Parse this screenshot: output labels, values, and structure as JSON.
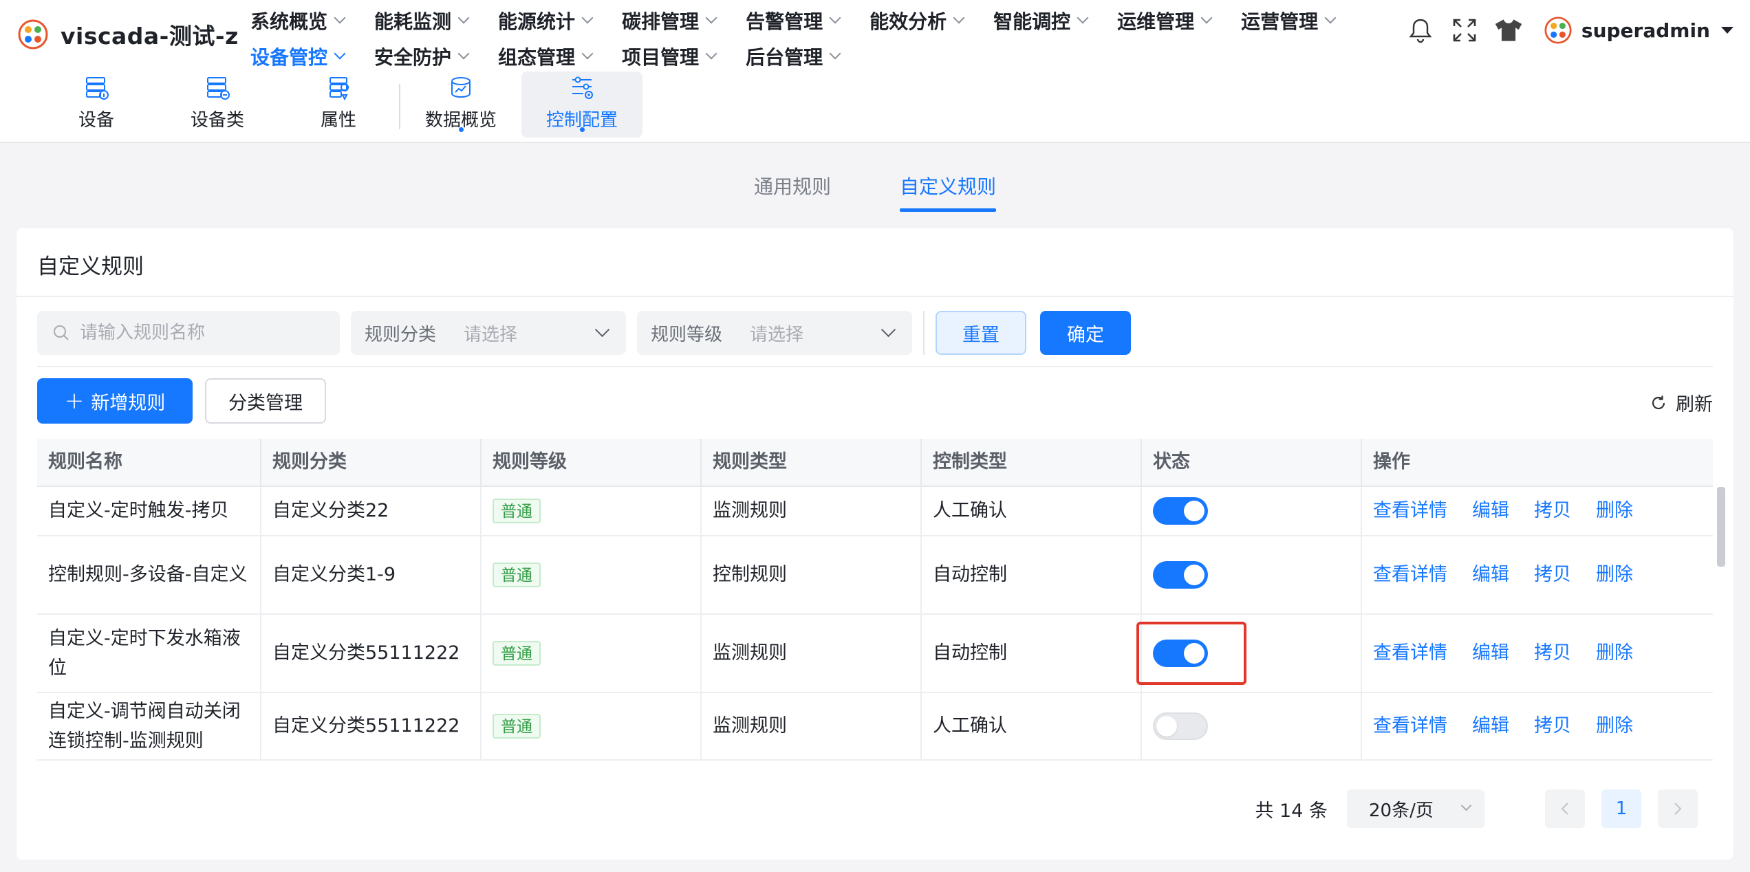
{
  "app": {
    "title": "viscada-测试-z"
  },
  "nav": {
    "row1": [
      "系统概览",
      "能耗监测",
      "能源统计",
      "碳排管理",
      "告警管理",
      "能效分析",
      "智能调控",
      "运维管理",
      "运营管理"
    ],
    "row2": [
      "设备管控",
      "安全防护",
      "组态管理",
      "项目管理",
      "后台管理"
    ],
    "active": "设备管控"
  },
  "subnav": {
    "items": [
      {
        "label": "设备",
        "icon": "device-icon"
      },
      {
        "label": "设备类",
        "icon": "device-class-icon"
      },
      {
        "label": "属性",
        "icon": "attribute-icon"
      },
      {
        "label": "数据概览",
        "icon": "data-overview-icon"
      },
      {
        "label": "控制配置",
        "icon": "control-config-icon"
      }
    ],
    "active": "控制配置"
  },
  "user": {
    "name": "superadmin"
  },
  "rule_tabs": {
    "general": "通用规则",
    "custom": "自定义规则",
    "active": "自定义规则"
  },
  "card": {
    "title": "自定义规则"
  },
  "filters": {
    "search_placeholder": "请输入规则名称",
    "category_label": "规则分类",
    "category_placeholder": "请选择",
    "level_label": "规则等级",
    "level_placeholder": "请选择",
    "reset_label": "重置",
    "confirm_label": "确定"
  },
  "actions": {
    "add_label": "新增规则",
    "category_manage_label": "分类管理",
    "refresh_label": "刷新"
  },
  "table": {
    "columns": [
      "规则名称",
      "规则分类",
      "规则等级",
      "规则类型",
      "控制类型",
      "状态",
      "操作"
    ],
    "rows": [
      {
        "name": "自定义-定时触发-拷贝",
        "category": "自定义分类22",
        "level": "普通",
        "type": "监测规则",
        "control": "人工确认",
        "enabled": true
      },
      {
        "name": "控制规则-多设备-自定义",
        "category": "自定义分类1-9",
        "level": "普通",
        "type": "控制规则",
        "control": "自动控制",
        "enabled": true
      },
      {
        "name": "自定义-定时下发水箱液位",
        "category": "自定义分类55111222",
        "level": "普通",
        "type": "监测规则",
        "control": "自动控制",
        "enabled": true
      },
      {
        "name": "自定义-调节阀自动关闭连锁控制-监测规则",
        "category": "自定义分类55111222",
        "level": "普通",
        "type": "监测规则",
        "control": "人工确认",
        "enabled": false
      }
    ],
    "ops": {
      "view": "查看详情",
      "edit": "编辑",
      "copy": "拷贝",
      "delete": "删除"
    }
  },
  "pagination": {
    "total_text": "共 14 条",
    "page_size": "20条/页",
    "current_page": "1"
  },
  "colors": {
    "primary": "#1677ff",
    "tag_green": "#2f9e44",
    "highlight": "#e2382b"
  }
}
